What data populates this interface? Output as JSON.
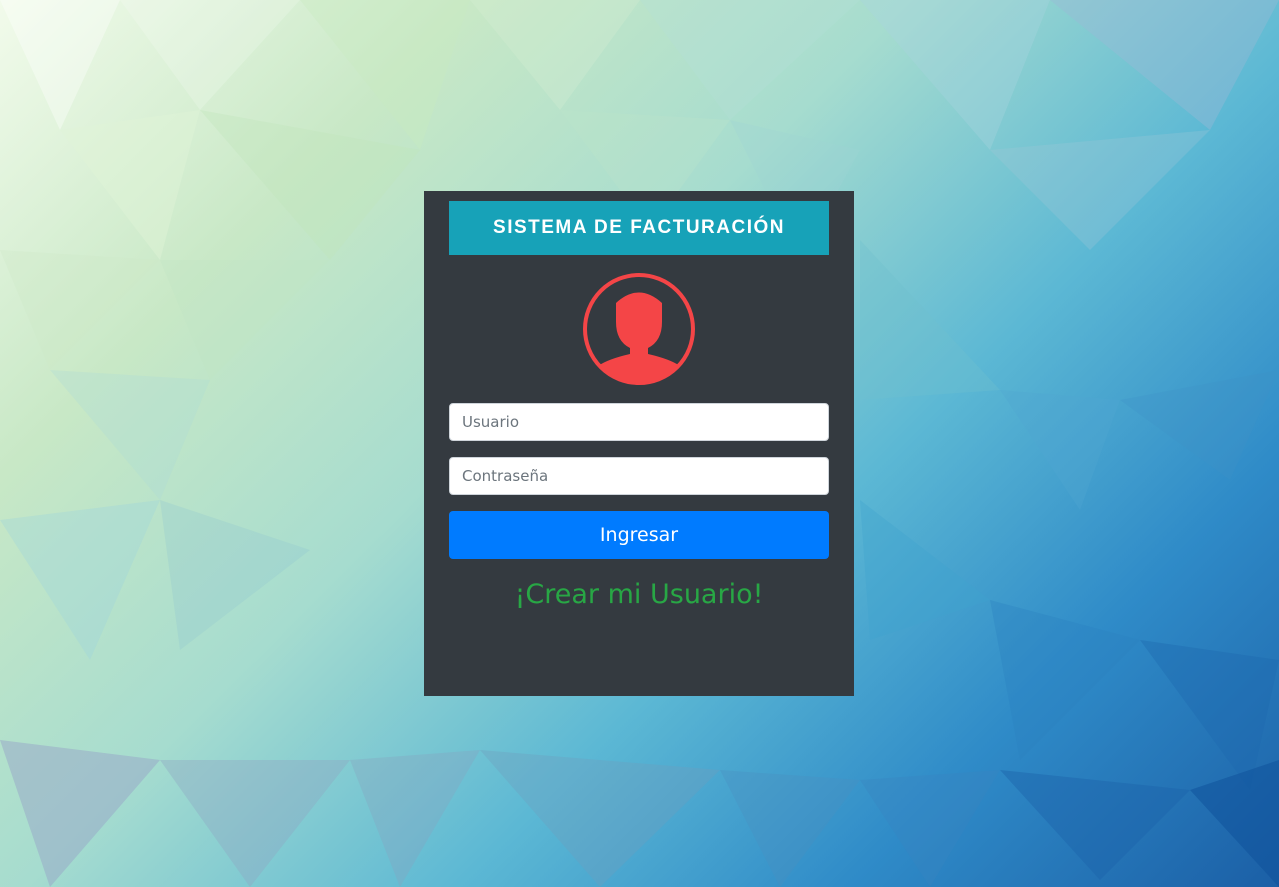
{
  "app": {
    "title": "SISTEMA DE FACTURACIÓN"
  },
  "login": {
    "avatar_icon": "user-silhouette-icon",
    "username_placeholder": "Usuario",
    "password_placeholder": "Contraseña",
    "submit_label": "Ingresar",
    "create_user_link": "¡Crear mi Usuario!"
  },
  "colors": {
    "panel": "#343a40",
    "header": "#17a2b8",
    "avatar": "#f44547",
    "button": "#007bff",
    "link": "#28a745"
  }
}
